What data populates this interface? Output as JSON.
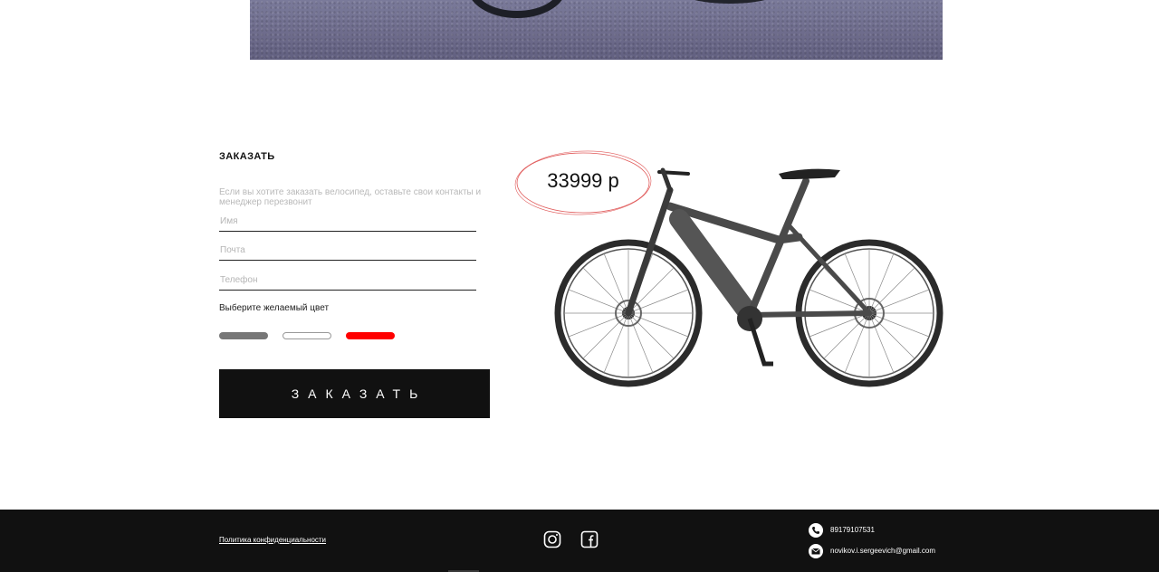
{
  "order": {
    "title": "ЗАКАЗАТЬ",
    "description": "Если вы хотите заказать велосипед, оставьте свои контакты и менеджер перезвонит",
    "fields": {
      "name_placeholder": "Имя",
      "email_placeholder": "Почта",
      "phone_placeholder": "Телефон"
    },
    "color_label": "Выберите желаемый цвет",
    "color_options": [
      {
        "name": "gray",
        "color": "#777777"
      },
      {
        "name": "white",
        "color": "#ffffff"
      },
      {
        "name": "red",
        "color": "#ff0000"
      }
    ],
    "submit_label": "ЗАКАЗАТЬ"
  },
  "product": {
    "price": "33999 р",
    "price_circle_color": "#e05a5a",
    "frame_color": "#4a4a4a"
  },
  "footer": {
    "privacy_link": "Политика конфиденциальности",
    "social": [
      "instagram-icon",
      "facebook-icon"
    ],
    "phone": "89179107531",
    "email": "novikov.i.sergeevich@gmail.com"
  }
}
